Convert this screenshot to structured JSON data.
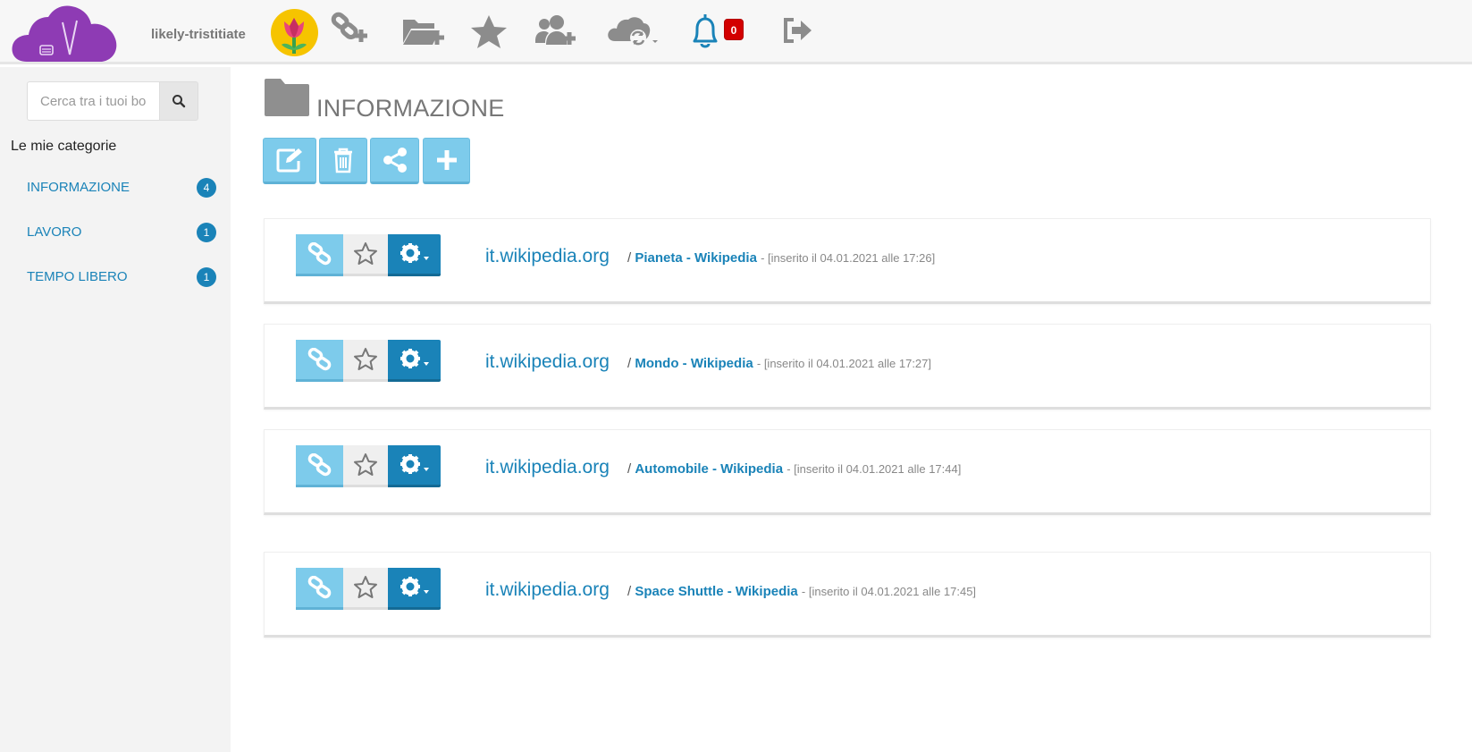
{
  "header": {
    "username": "likely-tristitiate",
    "notifications_count": "0",
    "icons": [
      "cloud-logo",
      "user-avatar",
      "add-link-icon",
      "add-folder-icon",
      "star-icon",
      "add-users-icon",
      "cloud-sync-icon",
      "bell-icon",
      "logout-icon"
    ]
  },
  "sidebar": {
    "search_placeholder": "Cerca tra i tuoi bookmark",
    "categories_heading": "Le mie categorie",
    "categories": [
      {
        "label": "INFORMAZIONE",
        "count": "4"
      },
      {
        "label": "LAVORO",
        "count": "1"
      },
      {
        "label": "TEMPO LIBERO",
        "count": "1"
      }
    ]
  },
  "main": {
    "title": "INFORMAZIONE",
    "actions": [
      "edit-icon",
      "trash-icon",
      "share-icon",
      "plus-icon"
    ],
    "bookmarks": [
      {
        "domain": "it.wikipedia.org",
        "separator": "/",
        "page": "Pianeta - Wikipedia",
        "meta": "- [inserito il 04.01.2021 alle 17:26]"
      },
      {
        "domain": "it.wikipedia.org",
        "separator": "/",
        "page": "Mondo - Wikipedia",
        "meta": "- [inserito il 04.01.2021 alle 17:27]"
      },
      {
        "domain": "it.wikipedia.org",
        "separator": "/",
        "page": "Automobile - Wikipedia",
        "meta": "- [inserito il 04.01.2021 alle 17:44]"
      },
      {
        "domain": "it.wikipedia.org",
        "separator": "/",
        "page": "Space Shuttle - Wikipedia",
        "meta": "- [inserito il 04.01.2021 alle 17:45]"
      }
    ]
  },
  "colors": {
    "accent": "#1a83b8",
    "light_accent": "#7dcbeb",
    "logo_purple": "#8e3bb4",
    "badge_red": "#d30000"
  }
}
